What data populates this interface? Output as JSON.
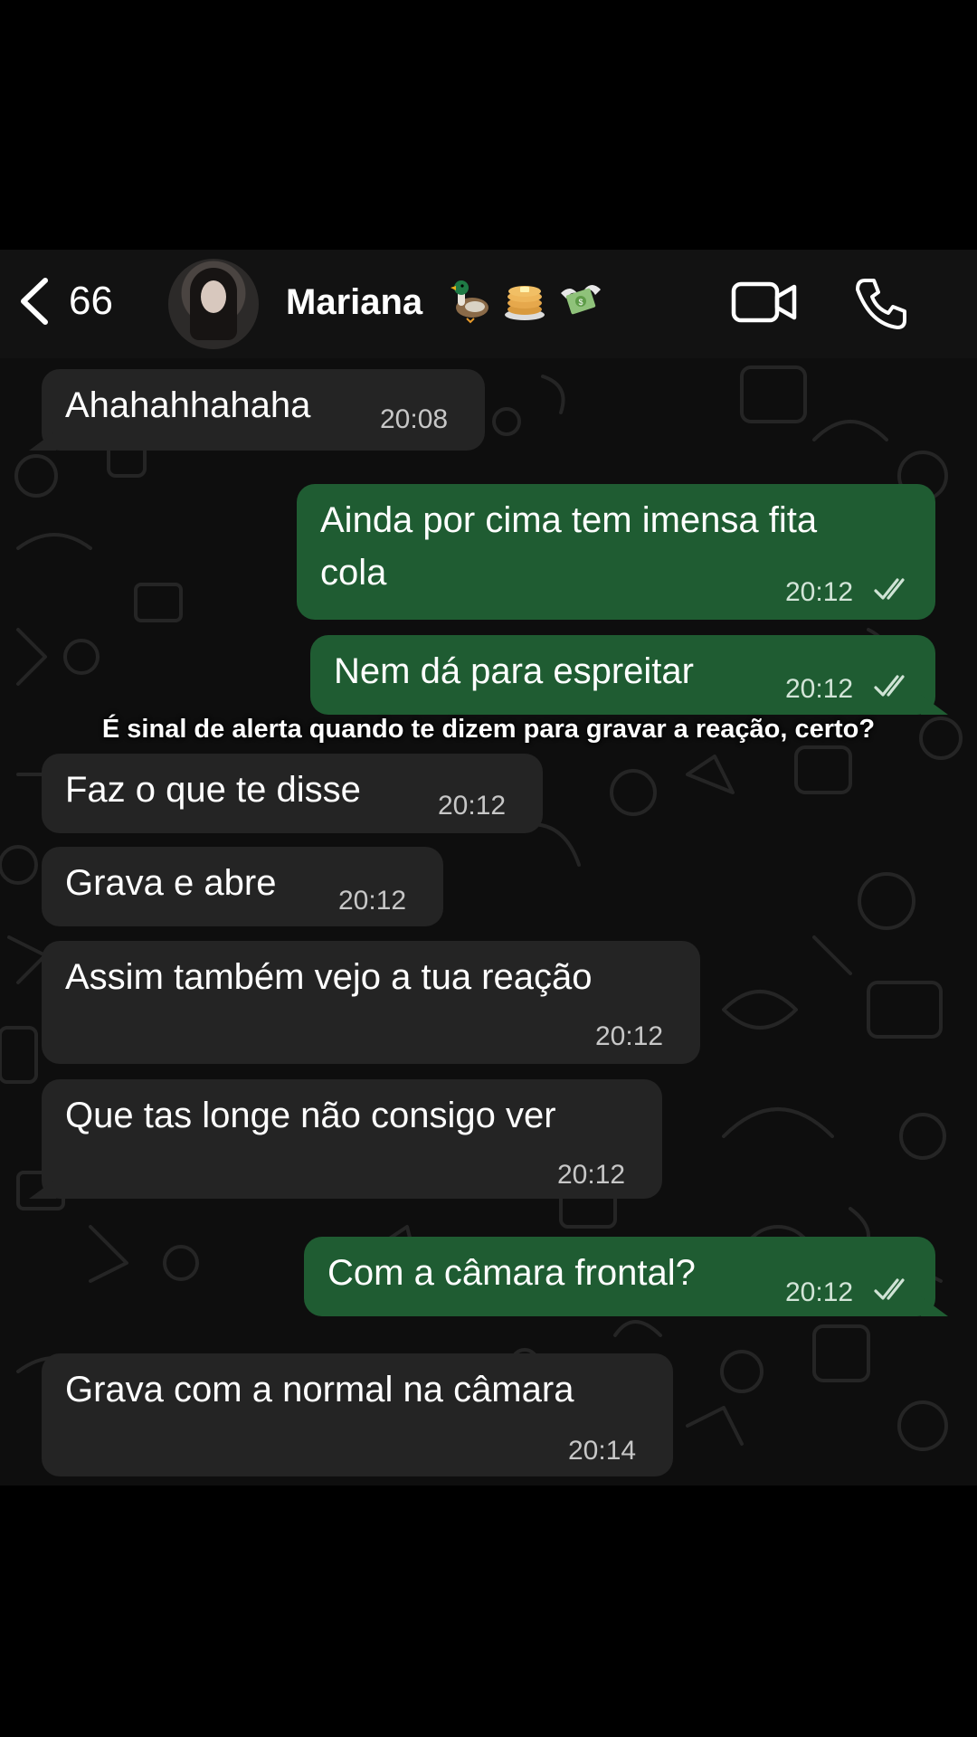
{
  "header": {
    "back_count": "66",
    "contact_name": "Mariana",
    "emoji_icons": [
      "duck-icon",
      "pancakes-icon",
      "money-with-wings-icon"
    ]
  },
  "caption": "É sinal de alerta quando te dizem para gravar a reação, certo?",
  "messages": [
    {
      "dir": "in",
      "text": "Ahahahhahaha",
      "time": "20:08"
    },
    {
      "dir": "out",
      "text": "Ainda por cima tem imensa fita",
      "text2": "cola",
      "time": "20:12",
      "read": true
    },
    {
      "dir": "out",
      "text": "Nem dá para espreitar",
      "time": "20:12",
      "read": true
    },
    {
      "dir": "in",
      "text": "Faz o que te disse",
      "time": "20:12"
    },
    {
      "dir": "in",
      "text": "Grava e abre",
      "time": "20:12"
    },
    {
      "dir": "in",
      "text": "Assim também vejo a tua reação",
      "time": "20:12"
    },
    {
      "dir": "in",
      "text": "Que tas longe não consigo ver",
      "time": "20:12"
    },
    {
      "dir": "out",
      "text": "Com a câmara frontal?",
      "time": "20:12",
      "read": true
    },
    {
      "dir": "in",
      "text": "Grava com a normal na câmara",
      "time": "20:14"
    }
  ],
  "colors": {
    "incoming_bubble": "#242424",
    "outgoing_bubble": "#1f5c32",
    "background": "#0e0e0e"
  }
}
